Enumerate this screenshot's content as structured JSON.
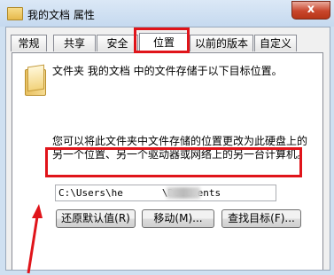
{
  "window": {
    "title": "我的文档 属性",
    "close_glyph": "x"
  },
  "tabs": [
    "常规",
    "共享",
    "安全",
    "位置",
    "以前的版本",
    "自定义"
  ],
  "active_tab": "位置",
  "folder_desc": "文件夹 我的文档 中的文件存储于以下目标位置。",
  "location_desc": "您可以将此文件夹中文件存储的位置更改为此硬盘上的另一个位置、另一个驱动器或网络上的另一台计算机。",
  "path": {
    "prefix": "C:\\Users\\he",
    "suffix": "\\Documents"
  },
  "buttons": {
    "restore": "还原默认值(R)",
    "move": "移动(M)...",
    "find_target": "查找目标(F)..."
  },
  "highlight_color": "#e0141a"
}
